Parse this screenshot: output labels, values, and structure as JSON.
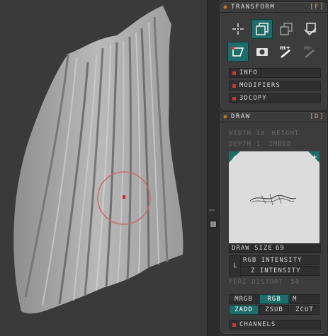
{
  "transform": {
    "title": "TRANSFORM",
    "shortcut": "[F]",
    "info_label": "INFO",
    "modifiers_label": "MODIFIERS",
    "copy3d_label": "3DCOPY"
  },
  "draw": {
    "title": "DRAW",
    "shortcut": "[D]",
    "width_label": "WIDTH",
    "width_value": "10",
    "height_label": "HEIGHT",
    "depth_label": "DEPTH",
    "depth_value": "1",
    "imbed_label": "IMBED",
    "draw_size_label": "DRAW SIZE",
    "draw_size_value": "69",
    "rgb_intensity_label": "RGB INTENSITY",
    "z_intensity_label": "Z INTENSITY",
    "l_label": "L",
    "peri_label": "PERI DISTORT",
    "peri_value": "50",
    "mrgb_label": "MRGB",
    "rgb_label": "RGB",
    "m_label": "M",
    "zadd_label": "ZADD",
    "zsub_label": "ZSUB",
    "zcut_label": "ZCUT",
    "channels_label": "CHANNELS"
  },
  "icons": [
    "move-icon",
    "copy-icon",
    "duplicate-icon",
    "paste-icon",
    "edit-mesh-icon",
    "snapshot-icon",
    "mark-icon",
    "unmark-icon"
  ],
  "colors": {
    "accent_teal": "#1f6d6a",
    "bullet_red": "#c43a3a",
    "header_dot": "#d98a3a",
    "cursor_ring": "#c96a6a"
  }
}
